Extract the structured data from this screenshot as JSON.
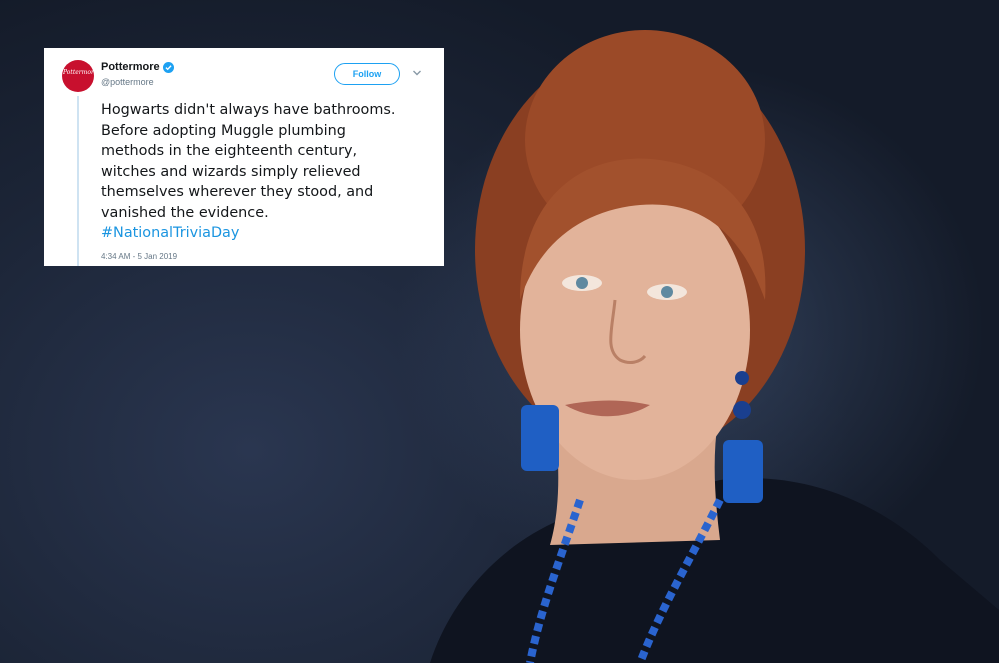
{
  "tweet": {
    "display_name": "Pottermore",
    "handle": "@pottermore",
    "avatar_text": "Pottermore",
    "follow_label": "Follow",
    "text_lines": [
      "Hogwarts didn't always have bathrooms.",
      "Before adopting Muggle plumbing",
      "methods in the eighteenth century,",
      "witches and wizards simply relieved",
      "themselves wherever they stood, and",
      "vanished the evidence."
    ],
    "hashtag": "#NationalTriviaDay",
    "timestamp": "4:34 AM - 5 Jan 2019",
    "verified_icon": "verified-badge-icon",
    "menu_icon": "chevron-down-icon"
  },
  "colors": {
    "accent": "#1da1f2",
    "hashtag": "#1b95e0",
    "avatar": "#c8102e",
    "background": "#1f2a3d",
    "earring": "#1f5fc4"
  }
}
